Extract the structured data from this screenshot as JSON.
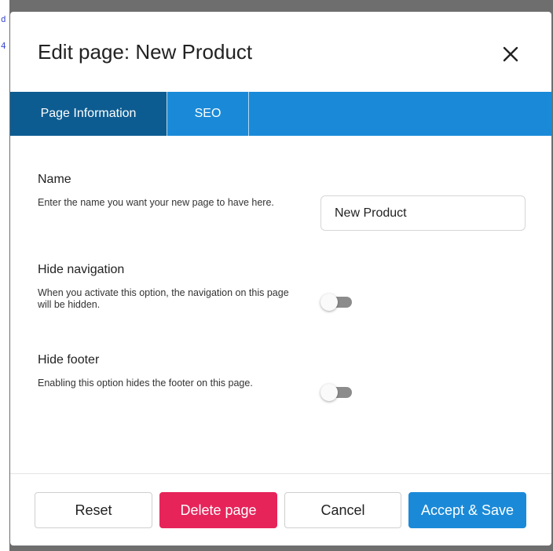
{
  "background": {
    "glyph_top": "d",
    "glyph_second": "4"
  },
  "dialog": {
    "title": "Edit page: New Product",
    "close_icon": "close-icon"
  },
  "tabs": [
    {
      "label": "Page Information",
      "active": true
    },
    {
      "label": "SEO",
      "active": false
    }
  ],
  "fields": {
    "name": {
      "title": "Name",
      "description": "Enter the name you want your new page to have here.",
      "value": "New Product"
    },
    "hide_navigation": {
      "title": "Hide navigation",
      "description": "When you activate this option, the navigation on this page will be hidden.",
      "enabled": false
    },
    "hide_footer": {
      "title": "Hide footer",
      "description": "Enabling this option hides the footer on this page.",
      "enabled": false
    }
  },
  "buttons": {
    "reset": "Reset",
    "delete": "Delete page",
    "cancel": "Cancel",
    "accept": "Accept & Save"
  },
  "colors": {
    "accent": "#1a8ad8",
    "active_tab": "#0d5c91",
    "danger": "#e6245a"
  }
}
